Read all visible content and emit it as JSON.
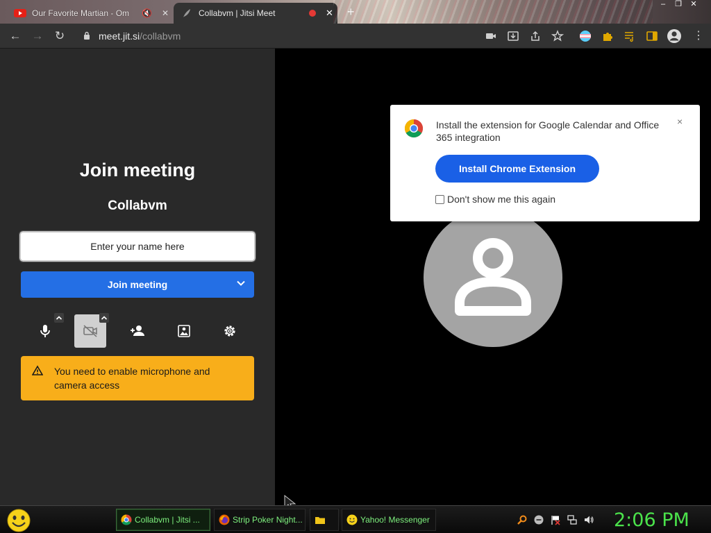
{
  "browser": {
    "tabs": [
      {
        "title": "Our Favorite Martian - Om",
        "state": "inactive"
      },
      {
        "title": "Collabvm | Jitsi Meet",
        "state": "active"
      }
    ],
    "url_host": "meet.jit.si",
    "url_path": "/collabvm"
  },
  "prejoin": {
    "title": "Join meeting",
    "room_name": "Collabvm",
    "name_placeholder": "Enter your name here",
    "join_button": "Join meeting",
    "warning": "You need to enable microphone and camera access"
  },
  "popup": {
    "text": "Install the extension for Google Calendar and Office 365 integration",
    "install_button": "Install Chrome Extension",
    "dont_show": "Don't show me this again"
  },
  "taskbar": {
    "tasks": [
      {
        "label": "Collabvm | Jitsi ...",
        "icon": "chrome-icon",
        "active": true
      },
      {
        "label": "Strip Poker Night...",
        "icon": "firefox-icon",
        "active": false
      },
      {
        "label": "",
        "icon": "folder-icon",
        "active": false
      },
      {
        "label": "Yahoo! Messenger",
        "icon": "yahoo-messenger-icon",
        "active": false
      }
    ],
    "clock": "2:06 PM"
  },
  "colors": {
    "left_pane_bg": "#292929",
    "join_blue": "#246fe5",
    "warning_yellow": "#f8ae1a",
    "install_blue": "#1a60e6",
    "clock_green": "#4be34b"
  }
}
